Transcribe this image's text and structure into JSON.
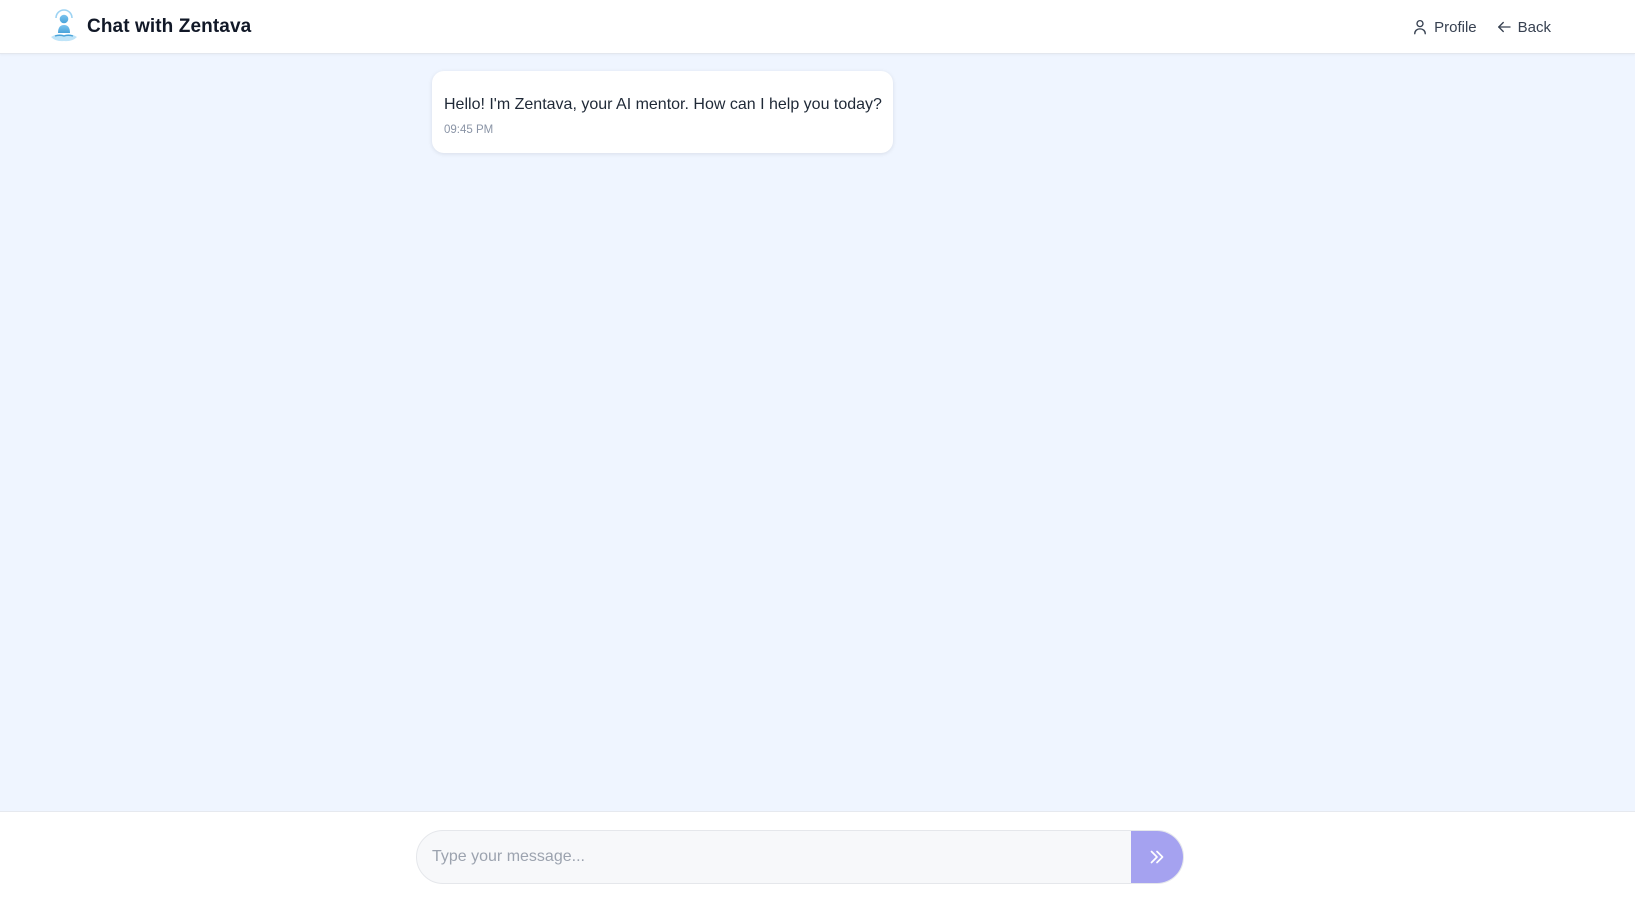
{
  "header": {
    "title": "Chat with Zentava",
    "logo_icon": "meditating-person-logo-icon",
    "nav": [
      {
        "label": "Profile",
        "icon": "user-icon"
      },
      {
        "label": "Back",
        "icon": "arrow-left-icon"
      }
    ]
  },
  "messages": [
    {
      "sender": "Zentava",
      "text": "Hello! I'm Zentava, your AI mentor. How can I help you today?",
      "time": "09:45 PM"
    }
  ],
  "composer": {
    "placeholder": "Type your message...",
    "value": "",
    "send_icon": "double-chevron-right-icon"
  },
  "colors": {
    "background": "#eff5ff",
    "header_bg": "#ffffff",
    "bubble_bg": "#ffffff",
    "send_button": "#a5a2f0",
    "logo_accent": "#5bb7e8"
  }
}
